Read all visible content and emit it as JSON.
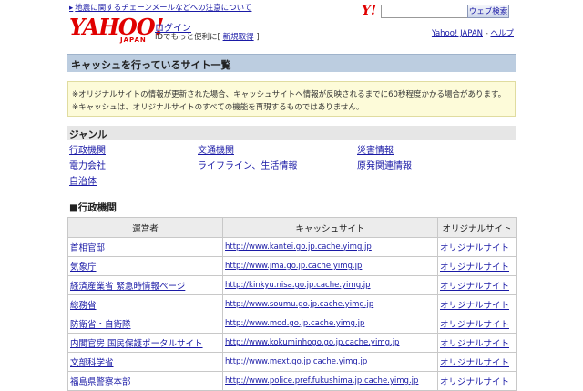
{
  "top_notice": "地震に関するチェーンメールなどへの注意について",
  "logo": {
    "text": "YAHOO!",
    "sub": "JAPAN"
  },
  "account": {
    "login": "ログイン",
    "id_text": "IDでもっと便利に[",
    "register": "新規取得",
    "id_close": "]"
  },
  "search": {
    "logo": "Y!",
    "placeholder": "",
    "button": "ウェブ検索"
  },
  "top_links": {
    "yahoo": "Yahoo! JAPAN",
    "sep": " - ",
    "help": "ヘルプ"
  },
  "page_title": "キャッシュを行っているサイト一覧",
  "notices": [
    "※オリジナルサイトの情報が更新された場合、キャッシュサイトへ情報が反映されるまでに60秒程度かかる場合があります。",
    "※キャッシュは、オリジナルサイトのすべての機能を再現するものではありません。"
  ],
  "genre": {
    "heading": "ジャンル",
    "items": [
      "行政機関",
      "交通機関",
      "災害情報",
      "電力会社",
      "ライフライン、生活情報",
      "原発関連情報",
      "自治体"
    ]
  },
  "section": "■行政機関",
  "table": {
    "headers": [
      "運営者",
      "キャッシュサイト",
      "オリジナルサイト"
    ],
    "rows": [
      [
        "首相官邸",
        "http://www.kantei.go.jp.cache.yimg.jp",
        "オリジナルサイト"
      ],
      [
        "気象庁",
        "http://www.jma.go.jp.cache.yimg.jp",
        "オリジナルサイト"
      ],
      [
        "経済産業省 緊急時情報ページ",
        "http://kinkyu.nisa.go.jp.cache.yimg.jp",
        "オリジナルサイト"
      ],
      [
        "総務省",
        "http://www.soumu.go.jp.cache.yimg.jp",
        "オリジナルサイト"
      ],
      [
        "防衛省・自衛隊",
        "http://www.mod.go.jp.cache.yimg.jp",
        "オリジナルサイト"
      ],
      [
        "内閣官房 国民保護ポータルサイト",
        "http://www.kokuminhogo.go.jp.cache.yimg.jp",
        "オリジナルサイト"
      ],
      [
        "文部科学省",
        "http://www.mext.go.jp.cache.yimg.jp",
        "オリジナルサイト"
      ],
      [
        "福島県警察本部",
        "http://www.police.pref.fukushima.jp.cache.yimg.jp",
        "オリジナルサイト"
      ]
    ]
  }
}
